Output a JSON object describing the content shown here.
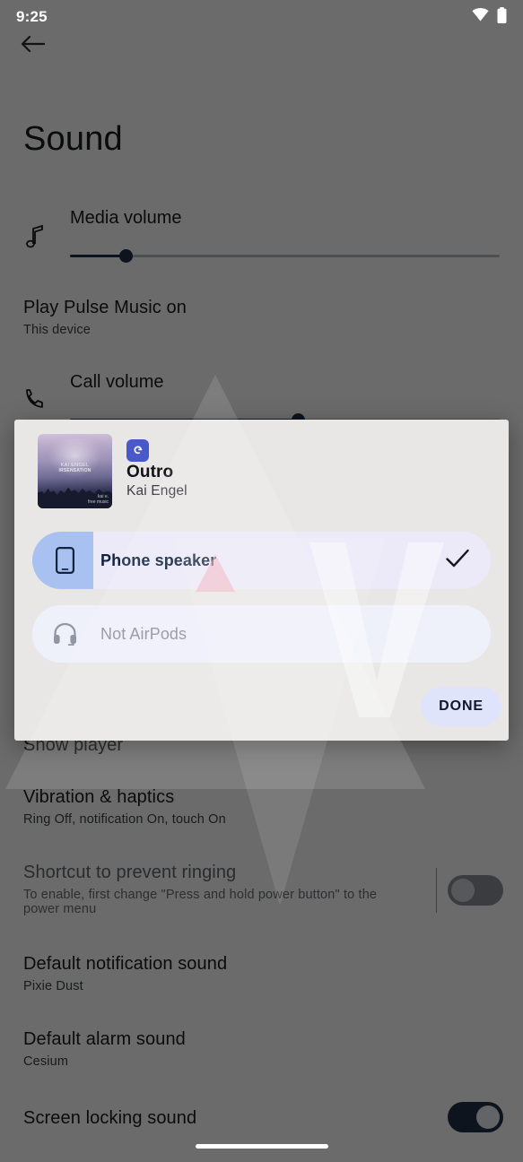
{
  "status_bar": {
    "time": "9:25",
    "icons": [
      "wifi-icon",
      "battery-icon"
    ]
  },
  "nav": {
    "back_icon": "back-arrow-icon"
  },
  "settings": {
    "title": "Sound",
    "media_volume": {
      "label": "Media volume",
      "icon": "music-note-icon",
      "value_percent": 13
    },
    "play_on": {
      "title": "Play Pulse Music on",
      "subtitle": "This device"
    },
    "call_volume": {
      "label": "Call volume",
      "icon": "phone-icon",
      "value_percent": 53
    },
    "show_player": {
      "title": "Show player"
    },
    "vibration": {
      "title": "Vibration & haptics",
      "subtitle": "Ring Off, notification On, touch On"
    },
    "shortcut": {
      "title": "Shortcut to prevent ringing",
      "subtitle": "To enable, first change \"Press and hold power button\" to the power menu",
      "toggle_on": false,
      "disabled": true
    },
    "notification_sound": {
      "title": "Default notification sound",
      "subtitle": "Pixie Dust"
    },
    "alarm_sound": {
      "title": "Default alarm sound",
      "subtitle": "Cesium"
    },
    "screen_locking_sound": {
      "title": "Screen locking sound",
      "toggle_on": true
    }
  },
  "dialog": {
    "app_icon": "pulse-music-app-icon",
    "album_art": {
      "icon": "album-artwork",
      "overlay_line1": "KAI ENGEL",
      "overlay_line2": "IRSENSATION",
      "corner_mark": "kai e.",
      "corner_mark2": "free music"
    },
    "track_title": "Outro",
    "track_artist": "Kai Engel",
    "devices": [
      {
        "label": "Phone speaker",
        "icon": "phone-speaker-icon",
        "selected": true,
        "disabled": false,
        "check_icon": "checkmark-icon",
        "volume_percent": 13
      },
      {
        "label": "Not AirPods",
        "icon": "headphones-icon",
        "selected": false,
        "disabled": true,
        "check_icon": "",
        "volume_percent": 0
      }
    ],
    "done_label": "DONE"
  },
  "colors": {
    "accent": "#1f3049",
    "selected_fill": "#a8c1f0",
    "row_bg": "#eceaf8",
    "done_bg": "#dfe4fb",
    "app_badge": "#4a59c9",
    "scrim": "rgba(0,0,0,0.58)"
  },
  "system": {
    "home_indicator": "home-indicator"
  }
}
